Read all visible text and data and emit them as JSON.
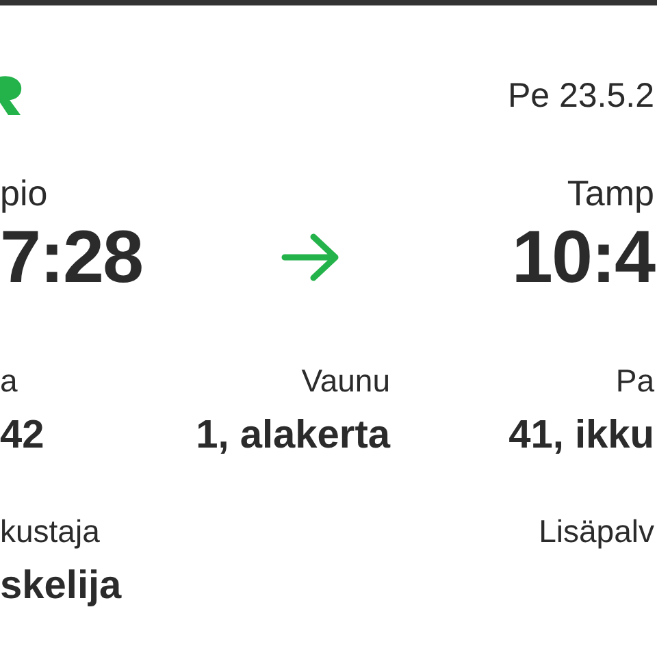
{
  "header": {
    "date": "Pe 23.5.2"
  },
  "journey": {
    "origin": {
      "station": "pio",
      "time": "7:28"
    },
    "destination": {
      "station": "Tamp",
      "time": "10:4"
    }
  },
  "details": [
    {
      "label": "a",
      "value": "42"
    },
    {
      "label": "Vaunu",
      "value": "1, alakerta"
    },
    {
      "label": "Pa",
      "value": "41, ikku"
    },
    {
      "label": "kustaja",
      "value": "skelija"
    },
    {
      "label": "Lisäpalv"
    }
  ]
}
